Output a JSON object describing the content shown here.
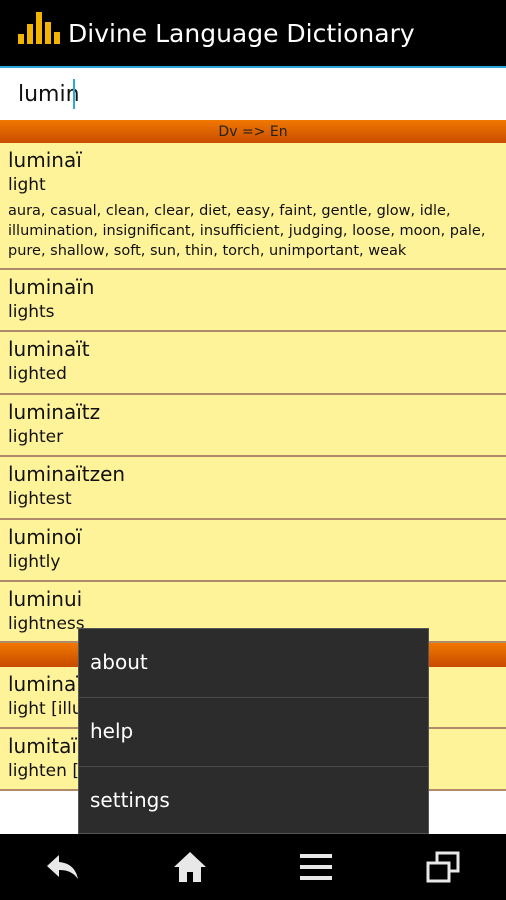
{
  "app": {
    "title": "Divine Language Dictionary",
    "logo_icon": "bars-logo-icon"
  },
  "search": {
    "value": "lumin",
    "placeholder": ""
  },
  "sections": [
    {
      "header": "Dv => En"
    },
    {
      "header": ""
    }
  ],
  "entries": [
    {
      "word": "luminaï",
      "translation": "light",
      "related": "aura, casual, clean, clear, diet, easy, faint, gentle, glow, idle, illumination, insignificant, insufficient, judging, loose, moon, pale, pure, shallow, soft, sun, thin, torch, unimportant, weak"
    },
    {
      "word": "luminaïn",
      "translation": "lights"
    },
    {
      "word": "luminaït",
      "translation": "lighted"
    },
    {
      "word": "luminaïtz",
      "translation": "lighter"
    },
    {
      "word": "luminaïtzen",
      "translation": "lightest"
    },
    {
      "word": "luminoï",
      "translation": "lightly"
    },
    {
      "word": "luminui",
      "translation": "lightness"
    }
  ],
  "entries2": [
    {
      "word": "luminaï",
      "translation": "light [illu"
    },
    {
      "word": "lumitaï",
      "translation": "lighten ["
    }
  ],
  "menu": {
    "items": [
      "about",
      "help",
      "settings"
    ]
  },
  "navbar": {
    "icons": [
      "back-icon",
      "home-icon",
      "menu-icon",
      "recent-apps-icon"
    ]
  },
  "colors": {
    "entry_bg": "#fff399",
    "header_orange": "#e06000",
    "accent": "#2aa8d6"
  }
}
